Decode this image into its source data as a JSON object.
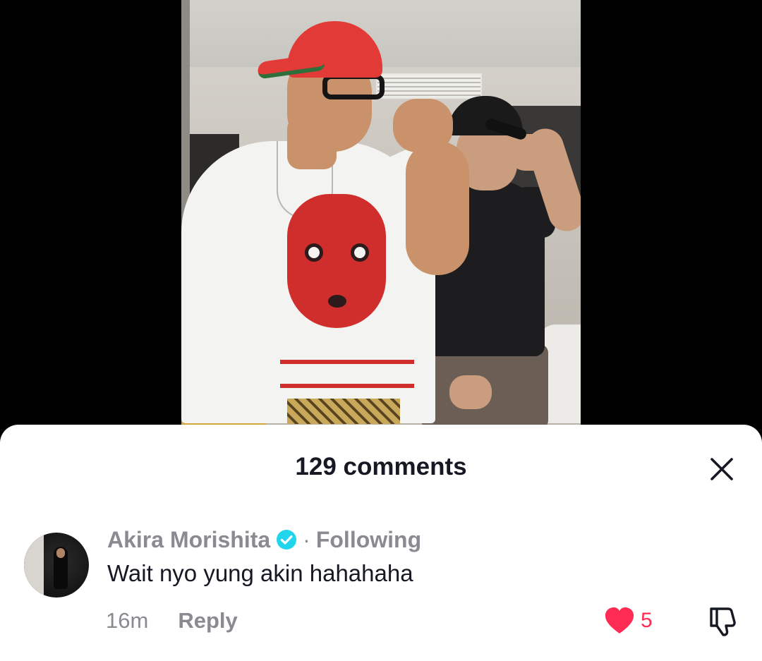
{
  "video": {
    "scene": "video-frame"
  },
  "comments_sheet": {
    "title": "129 comments",
    "close_icon": "close-icon",
    "comment": {
      "username": "Akira Morishita",
      "verified_icon": "verified-badge-icon",
      "separator": "·",
      "follow_state": "Following",
      "text": "Wait nyo yung akin hahahaha",
      "time": "16m",
      "reply_label": "Reply",
      "like_count": "5",
      "like_icon": "heart-icon",
      "dislike_icon": "thumbs-down-icon"
    }
  },
  "colors": {
    "like_red": "#fe2c55",
    "verified_blue": "#20d5ec",
    "text_primary": "#161823",
    "text_secondary": "#8a8b91"
  }
}
